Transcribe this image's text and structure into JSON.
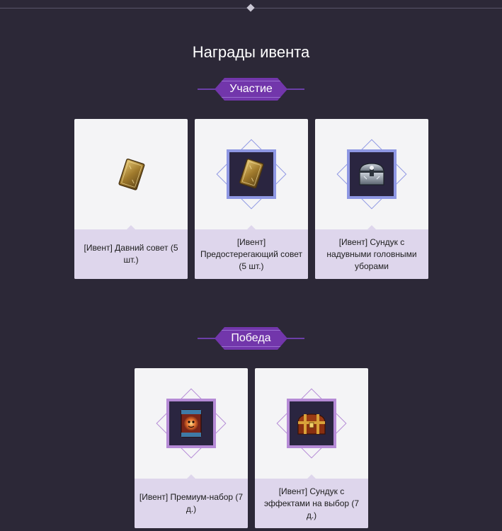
{
  "page": {
    "title": "Награды ивента"
  },
  "colors": {
    "background": "#2c2837",
    "badge": "#7236ab",
    "frame_blue": "#8e97e3",
    "frame_purple": "#b58ad6",
    "label_bg": "#ded6ec"
  },
  "sections": [
    {
      "title": "Участие",
      "items": [
        {
          "label": "[Ивент] Давний совет (5 шт.)",
          "icon": "card-icon",
          "framed": false
        },
        {
          "label": "[Ивент] Предостерегающий совет (5 шт.)",
          "icon": "card-icon",
          "framed": true,
          "frame": "blue"
        },
        {
          "label": "[Ивент] Сундук с надувными головными уборами",
          "icon": "silver-chest-icon",
          "framed": true,
          "frame": "blue"
        }
      ]
    },
    {
      "title": "Победа",
      "items": [
        {
          "label": "[Ивент] Премиум-набор (7 д.)",
          "icon": "premium-pack-icon",
          "framed": true,
          "frame": "purple"
        },
        {
          "label": "[Ивент] Сундук с эффектами на выбор (7 д.)",
          "icon": "treasure-chest-icon",
          "framed": true,
          "frame": "purple"
        }
      ]
    }
  ]
}
